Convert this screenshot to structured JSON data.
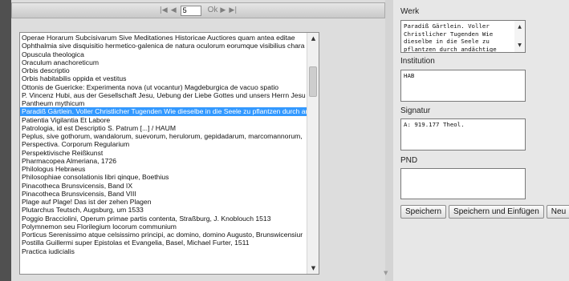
{
  "pager": {
    "first_label": "|◀",
    "prev_label": "◀",
    "page_value": "5",
    "ok_label": "Ok",
    "next_label": "▶",
    "last_label": "▶|"
  },
  "list": {
    "items": [
      "Operae Horarum Subcisivarum Sive Meditationes Historicae Auctiores quam antea editae",
      "Ophthalmia sive disquisitio hermetico-galenica de natura oculorum eorumque visibilius chara",
      "Opuscula theologica",
      "Oraculum anachoreticum",
      "Orbis descriptio",
      "Orbis habitabilis oppida et vestitus",
      "Ottonis de Guericke: Experimenta nova (ut vocantur) Magdeburgica de vacuo spatio",
      "P. Vincenz Hubi, aus der Gesellschaft Jesu, Uebung der Liebe Gottes und unsers Herrn Jesu",
      "Pantheum mythicum",
      "Paradiß Gärtlein. Voller Christlicher Tugenden Wie dieselbe in die Seele zu pflantzen durch an",
      "Patientia Vigilantia Et Labore",
      "Patrologia, id est Descriptio S. Patrum [...] / HAUM",
      "Peplus, sive gothorum, wandalorum, suevorum, herulorum, gepidadarum, marcomannorum,",
      "Perspectiva. Corporum Regularium",
      "Perspektivische Reißkunst",
      "Pharmacopea Almeriana, 1726",
      "Philologus Hebraeus",
      "Philosophiae consolationis libri qinque, Boethius",
      "Pinacotheca Brunsvicensis, Band IX",
      "Pinacotheca Brunsvicensis, Band VIII",
      "Plage auf Plage! Das ist der zehen Plagen",
      "Plutarchus Teutsch, Augsburg, um 1533",
      "Poggio Bracciolini, Operum primae partis contenta, Straßburg, J. Knoblouch 1513",
      "Polymnemon seu Florilegium locorum communium",
      "Porticus Serenissimo atque celsissimo principi, ac domino, domino Augusto, Brunswicensiur",
      "Postilla Guillermi super Epistolas et Evangelia, Basel, Michael Furter, 1511",
      "Practica iudicialis"
    ],
    "selected_index": 9,
    "scroll_up": "▲",
    "scroll_down": "▼"
  },
  "form": {
    "werk": {
      "label": "Werk",
      "value": "Paradiß Gärtlein. Voller Christlicher Tugenden Wie dieselbe in die Seele zu pflantzen durch andächtige"
    },
    "institution": {
      "label": "Institution",
      "value": "HAB"
    },
    "signatur": {
      "label": "Signatur",
      "value": "A: 919.177 Theol."
    },
    "pnd": {
      "label": "PND",
      "value": ""
    }
  },
  "buttons": {
    "save": "Speichern",
    "save_insert": "Speichern und Einfügen",
    "new": "Neu"
  }
}
